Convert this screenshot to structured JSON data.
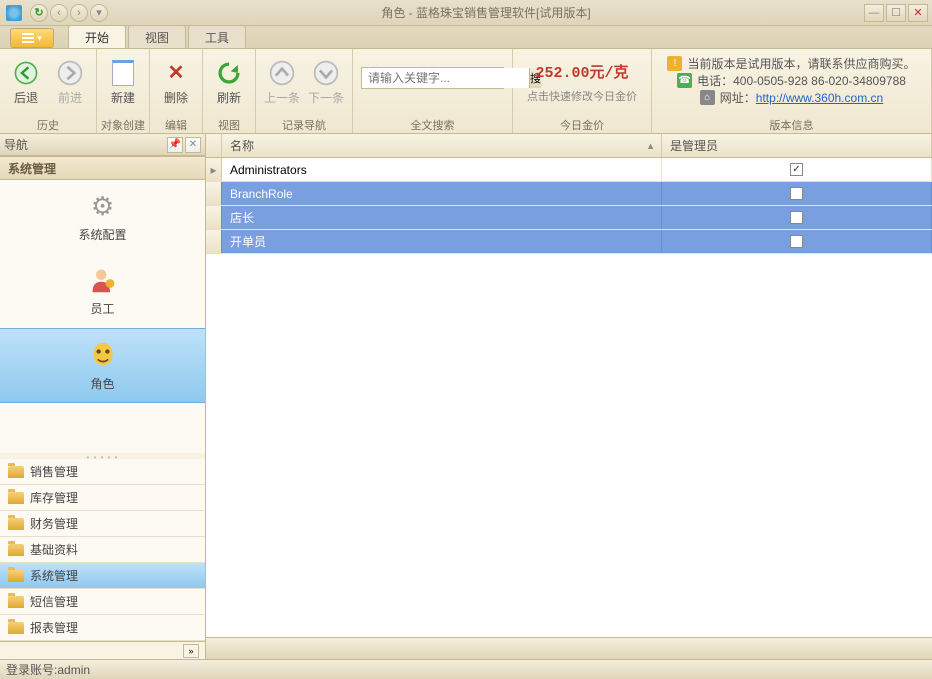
{
  "title": "角色 - 蓝格珠宝销售管理软件[试用版本]",
  "tabs": {
    "start": "开始",
    "view": "视图",
    "tool": "工具"
  },
  "ribbon": {
    "history": {
      "label": "历史",
      "back": "后退",
      "forward": "前进"
    },
    "create": {
      "label": "对象创建",
      "new": "新建"
    },
    "edit": {
      "label": "编辑",
      "del": "删除"
    },
    "viewgrp": {
      "label": "视图",
      "refresh": "刷新"
    },
    "recordnav": {
      "label": "记录导航",
      "prev": "上一条",
      "next": "下一条"
    },
    "search": {
      "label": "全文搜索",
      "placeholder": "请输入关键字...",
      "btn": "搜"
    },
    "price": {
      "label": "今日金价",
      "value": "252.00元/克",
      "hint": "点击快速修改今日金价"
    },
    "info": {
      "label": "版本信息",
      "line1": "当前版本是试用版本，请联系供应商购买。",
      "line2_label": "电话：",
      "line2_value": "400-0505-928  86-020-34809788",
      "line3_label": "网址：",
      "line3_link": "http://www.360h.com.cn"
    }
  },
  "sidebar": {
    "title": "导航",
    "section": "系统管理",
    "icons": [
      {
        "label": "系统配置"
      },
      {
        "label": "员工"
      },
      {
        "label": "角色"
      }
    ],
    "folders": [
      "销售管理",
      "库存管理",
      "财务管理",
      "基础资料",
      "系统管理",
      "短信管理",
      "报表管理"
    ]
  },
  "grid": {
    "col_name": "名称",
    "col_admin": "是管理员",
    "rows": [
      {
        "name": "Administrators",
        "admin": true,
        "selected": false,
        "current": true
      },
      {
        "name": "BranchRole",
        "admin": false,
        "selected": true
      },
      {
        "name": "店长",
        "admin": false,
        "selected": true
      },
      {
        "name": "开单员",
        "admin": false,
        "selected": true
      }
    ]
  },
  "status": {
    "label": "登录账号: ",
    "user": "admin"
  }
}
